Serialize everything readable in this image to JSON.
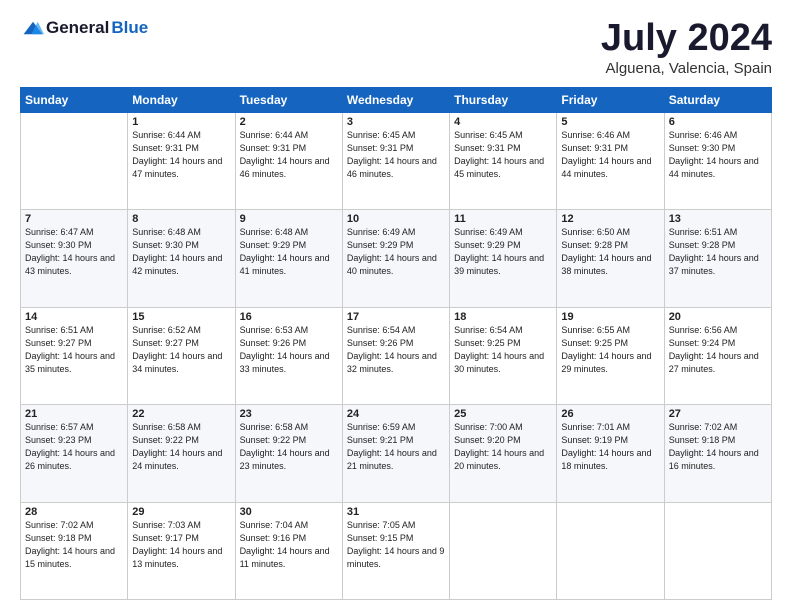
{
  "header": {
    "logo_general": "General",
    "logo_blue": "Blue",
    "month_title": "July 2024",
    "location": "Alguena, Valencia, Spain"
  },
  "weekdays": [
    "Sunday",
    "Monday",
    "Tuesday",
    "Wednesday",
    "Thursday",
    "Friday",
    "Saturday"
  ],
  "weeks": [
    [
      {
        "num": "",
        "sunrise": "",
        "sunset": "",
        "daylight": ""
      },
      {
        "num": "1",
        "sunrise": "Sunrise: 6:44 AM",
        "sunset": "Sunset: 9:31 PM",
        "daylight": "Daylight: 14 hours and 47 minutes."
      },
      {
        "num": "2",
        "sunrise": "Sunrise: 6:44 AM",
        "sunset": "Sunset: 9:31 PM",
        "daylight": "Daylight: 14 hours and 46 minutes."
      },
      {
        "num": "3",
        "sunrise": "Sunrise: 6:45 AM",
        "sunset": "Sunset: 9:31 PM",
        "daylight": "Daylight: 14 hours and 46 minutes."
      },
      {
        "num": "4",
        "sunrise": "Sunrise: 6:45 AM",
        "sunset": "Sunset: 9:31 PM",
        "daylight": "Daylight: 14 hours and 45 minutes."
      },
      {
        "num": "5",
        "sunrise": "Sunrise: 6:46 AM",
        "sunset": "Sunset: 9:31 PM",
        "daylight": "Daylight: 14 hours and 44 minutes."
      },
      {
        "num": "6",
        "sunrise": "Sunrise: 6:46 AM",
        "sunset": "Sunset: 9:30 PM",
        "daylight": "Daylight: 14 hours and 44 minutes."
      }
    ],
    [
      {
        "num": "7",
        "sunrise": "Sunrise: 6:47 AM",
        "sunset": "Sunset: 9:30 PM",
        "daylight": "Daylight: 14 hours and 43 minutes."
      },
      {
        "num": "8",
        "sunrise": "Sunrise: 6:48 AM",
        "sunset": "Sunset: 9:30 PM",
        "daylight": "Daylight: 14 hours and 42 minutes."
      },
      {
        "num": "9",
        "sunrise": "Sunrise: 6:48 AM",
        "sunset": "Sunset: 9:29 PM",
        "daylight": "Daylight: 14 hours and 41 minutes."
      },
      {
        "num": "10",
        "sunrise": "Sunrise: 6:49 AM",
        "sunset": "Sunset: 9:29 PM",
        "daylight": "Daylight: 14 hours and 40 minutes."
      },
      {
        "num": "11",
        "sunrise": "Sunrise: 6:49 AM",
        "sunset": "Sunset: 9:29 PM",
        "daylight": "Daylight: 14 hours and 39 minutes."
      },
      {
        "num": "12",
        "sunrise": "Sunrise: 6:50 AM",
        "sunset": "Sunset: 9:28 PM",
        "daylight": "Daylight: 14 hours and 38 minutes."
      },
      {
        "num": "13",
        "sunrise": "Sunrise: 6:51 AM",
        "sunset": "Sunset: 9:28 PM",
        "daylight": "Daylight: 14 hours and 37 minutes."
      }
    ],
    [
      {
        "num": "14",
        "sunrise": "Sunrise: 6:51 AM",
        "sunset": "Sunset: 9:27 PM",
        "daylight": "Daylight: 14 hours and 35 minutes."
      },
      {
        "num": "15",
        "sunrise": "Sunrise: 6:52 AM",
        "sunset": "Sunset: 9:27 PM",
        "daylight": "Daylight: 14 hours and 34 minutes."
      },
      {
        "num": "16",
        "sunrise": "Sunrise: 6:53 AM",
        "sunset": "Sunset: 9:26 PM",
        "daylight": "Daylight: 14 hours and 33 minutes."
      },
      {
        "num": "17",
        "sunrise": "Sunrise: 6:54 AM",
        "sunset": "Sunset: 9:26 PM",
        "daylight": "Daylight: 14 hours and 32 minutes."
      },
      {
        "num": "18",
        "sunrise": "Sunrise: 6:54 AM",
        "sunset": "Sunset: 9:25 PM",
        "daylight": "Daylight: 14 hours and 30 minutes."
      },
      {
        "num": "19",
        "sunrise": "Sunrise: 6:55 AM",
        "sunset": "Sunset: 9:25 PM",
        "daylight": "Daylight: 14 hours and 29 minutes."
      },
      {
        "num": "20",
        "sunrise": "Sunrise: 6:56 AM",
        "sunset": "Sunset: 9:24 PM",
        "daylight": "Daylight: 14 hours and 27 minutes."
      }
    ],
    [
      {
        "num": "21",
        "sunrise": "Sunrise: 6:57 AM",
        "sunset": "Sunset: 9:23 PM",
        "daylight": "Daylight: 14 hours and 26 minutes."
      },
      {
        "num": "22",
        "sunrise": "Sunrise: 6:58 AM",
        "sunset": "Sunset: 9:22 PM",
        "daylight": "Daylight: 14 hours and 24 minutes."
      },
      {
        "num": "23",
        "sunrise": "Sunrise: 6:58 AM",
        "sunset": "Sunset: 9:22 PM",
        "daylight": "Daylight: 14 hours and 23 minutes."
      },
      {
        "num": "24",
        "sunrise": "Sunrise: 6:59 AM",
        "sunset": "Sunset: 9:21 PM",
        "daylight": "Daylight: 14 hours and 21 minutes."
      },
      {
        "num": "25",
        "sunrise": "Sunrise: 7:00 AM",
        "sunset": "Sunset: 9:20 PM",
        "daylight": "Daylight: 14 hours and 20 minutes."
      },
      {
        "num": "26",
        "sunrise": "Sunrise: 7:01 AM",
        "sunset": "Sunset: 9:19 PM",
        "daylight": "Daylight: 14 hours and 18 minutes."
      },
      {
        "num": "27",
        "sunrise": "Sunrise: 7:02 AM",
        "sunset": "Sunset: 9:18 PM",
        "daylight": "Daylight: 14 hours and 16 minutes."
      }
    ],
    [
      {
        "num": "28",
        "sunrise": "Sunrise: 7:02 AM",
        "sunset": "Sunset: 9:18 PM",
        "daylight": "Daylight: 14 hours and 15 minutes."
      },
      {
        "num": "29",
        "sunrise": "Sunrise: 7:03 AM",
        "sunset": "Sunset: 9:17 PM",
        "daylight": "Daylight: 14 hours and 13 minutes."
      },
      {
        "num": "30",
        "sunrise": "Sunrise: 7:04 AM",
        "sunset": "Sunset: 9:16 PM",
        "daylight": "Daylight: 14 hours and 11 minutes."
      },
      {
        "num": "31",
        "sunrise": "Sunrise: 7:05 AM",
        "sunset": "Sunset: 9:15 PM",
        "daylight": "Daylight: 14 hours and 9 minutes."
      },
      {
        "num": "",
        "sunrise": "",
        "sunset": "",
        "daylight": ""
      },
      {
        "num": "",
        "sunrise": "",
        "sunset": "",
        "daylight": ""
      },
      {
        "num": "",
        "sunrise": "",
        "sunset": "",
        "daylight": ""
      }
    ]
  ]
}
